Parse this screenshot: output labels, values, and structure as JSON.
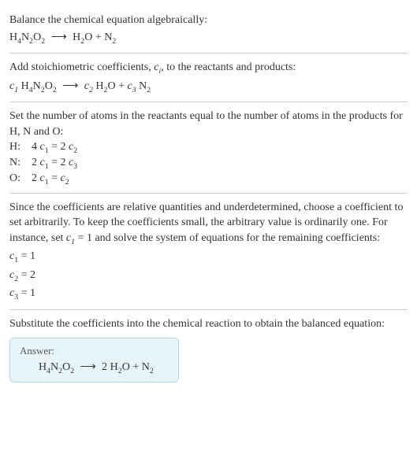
{
  "section1": {
    "instruction": "Balance the chemical equation algebraically:",
    "reactant_h": "H",
    "reactant_h_sub": "4",
    "reactant_n": "N",
    "reactant_n_sub": "2",
    "reactant_o": "O",
    "reactant_o_sub": "2",
    "arrow": "⟶",
    "prod1_h": "H",
    "prod1_h_sub": "2",
    "prod1_o": "O",
    "plus": " + ",
    "prod2_n": "N",
    "prod2_n_sub": "2"
  },
  "section2": {
    "instruction_a": "Add stoichiometric coefficients, ",
    "ci_c": "c",
    "ci_i": "i",
    "instruction_b": ", to the reactants and products:",
    "c1_c": "c",
    "c1_sub": "1",
    "space": " ",
    "reactant_h": "H",
    "reactant_h_sub": "4",
    "reactant_n": "N",
    "reactant_n_sub": "2",
    "reactant_o": "O",
    "reactant_o_sub": "2",
    "arrow": "⟶",
    "c2_c": "c",
    "c2_sub": "2",
    "prod1_h": "H",
    "prod1_h_sub": "2",
    "prod1_o": "O",
    "plus": " + ",
    "c3_c": "c",
    "c3_sub": "3",
    "prod2_n": "N",
    "prod2_n_sub": "2"
  },
  "section3": {
    "instruction": "Set the number of atoms in the reactants equal to the number of atoms in the products for H, N and O:",
    "rows": {
      "h": {
        "label": "H: ",
        "lhs_coef": "4 ",
        "lhs_c": "c",
        "lhs_sub": "1",
        "eq": " = 2 ",
        "rhs_c": "c",
        "rhs_sub": "2"
      },
      "n": {
        "label": "N: ",
        "lhs_coef": "2 ",
        "lhs_c": "c",
        "lhs_sub": "1",
        "eq": " = 2 ",
        "rhs_c": "c",
        "rhs_sub": "3"
      },
      "o": {
        "label": "O: ",
        "lhs_coef": "2 ",
        "lhs_c": "c",
        "lhs_sub": "1",
        "eq": " = ",
        "rhs_c": "c",
        "rhs_sub": "2"
      }
    }
  },
  "section4": {
    "instruction_a": "Since the coefficients are relative quantities and underdetermined, choose a coefficient to set arbitrarily. To keep the coefficients small, the arbitrary value is ordinarily one. For instance, set ",
    "set_c": "c",
    "set_sub": "1",
    "instruction_b": " = 1 and solve the system of equations for the remaining coefficients:",
    "sol": {
      "c1": {
        "c": "c",
        "sub": "1",
        "val": " = 1"
      },
      "c2": {
        "c": "c",
        "sub": "2",
        "val": " = 2"
      },
      "c3": {
        "c": "c",
        "sub": "3",
        "val": " = 1"
      }
    }
  },
  "section5": {
    "instruction": "Substitute the coefficients into the chemical reaction to obtain the balanced equation:",
    "answer_label": "Answer:",
    "reactant_h": "H",
    "reactant_h_sub": "4",
    "reactant_n": "N",
    "reactant_n_sub": "2",
    "reactant_o": "O",
    "reactant_o_sub": "2",
    "arrow": "⟶",
    "coef2": "2 ",
    "prod1_h": "H",
    "prod1_h_sub": "2",
    "prod1_o": "O",
    "plus": " + ",
    "prod2_n": "N",
    "prod2_n_sub": "2"
  }
}
